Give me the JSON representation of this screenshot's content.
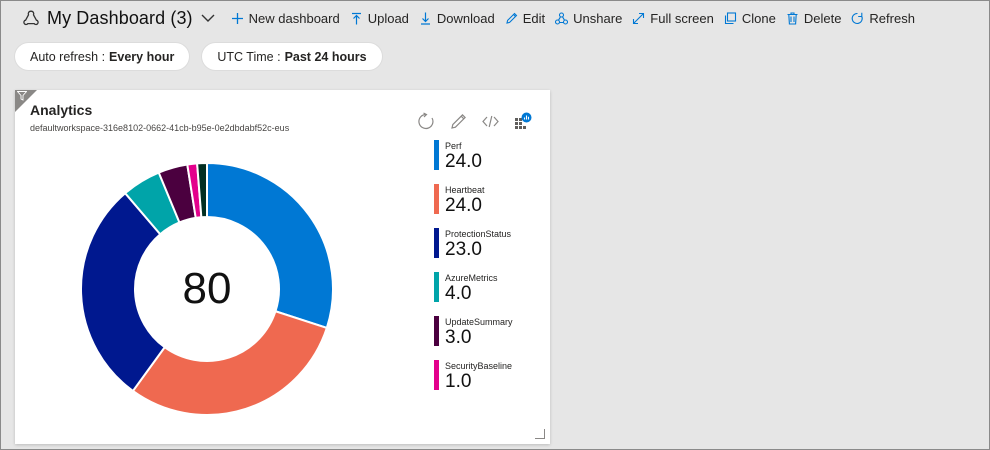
{
  "header": {
    "title": "My Dashboard (3)",
    "actions": [
      {
        "label": "New dashboard",
        "icon": "plus-icon"
      },
      {
        "label": "Upload",
        "icon": "upload-icon"
      },
      {
        "label": "Download",
        "icon": "download-icon"
      },
      {
        "label": "Edit",
        "icon": "pencil-icon"
      },
      {
        "label": "Unshare",
        "icon": "unshare-icon"
      },
      {
        "label": "Full screen",
        "icon": "fullscreen-icon"
      },
      {
        "label": "Clone",
        "icon": "clone-icon"
      },
      {
        "label": "Delete",
        "icon": "trash-icon"
      },
      {
        "label": "Refresh",
        "icon": "refresh-icon"
      }
    ]
  },
  "filters": {
    "auto_refresh": {
      "label": "Auto refresh :",
      "value": "Every hour"
    },
    "time": {
      "label": "UTC Time :",
      "value": "Past 24 hours"
    }
  },
  "tile": {
    "title": "Analytics",
    "subtitle": "defaultworkspace-316e8102-0662-41cb-b95e-0e2dbdabf52c-eus",
    "actions": [
      "refresh-icon",
      "pencil-icon",
      "code-icon",
      "chart-badge-icon"
    ]
  },
  "chart_data": {
    "type": "pie",
    "variant": "donut",
    "center_label": "80",
    "series": [
      {
        "name": "Perf",
        "value": 24,
        "label": "24.0",
        "color": "#0078d4"
      },
      {
        "name": "Heartbeat",
        "value": 24,
        "label": "24.0",
        "color": "#ef6950"
      },
      {
        "name": "ProtectionStatus",
        "value": 23,
        "label": "23.0",
        "color": "#00188f"
      },
      {
        "name": "AzureMetrics",
        "value": 4,
        "label": "4.0",
        "color": "#00a4a9"
      },
      {
        "name": "UpdateSummary",
        "value": 3,
        "label": "3.0",
        "color": "#4b003f"
      },
      {
        "name": "SecurityBaseline",
        "value": 1,
        "label": "1.0",
        "color": "#e3008c"
      }
    ],
    "extra_slices": [
      {
        "value": 1,
        "color": "#022f22"
      }
    ],
    "legend_position": "right"
  }
}
